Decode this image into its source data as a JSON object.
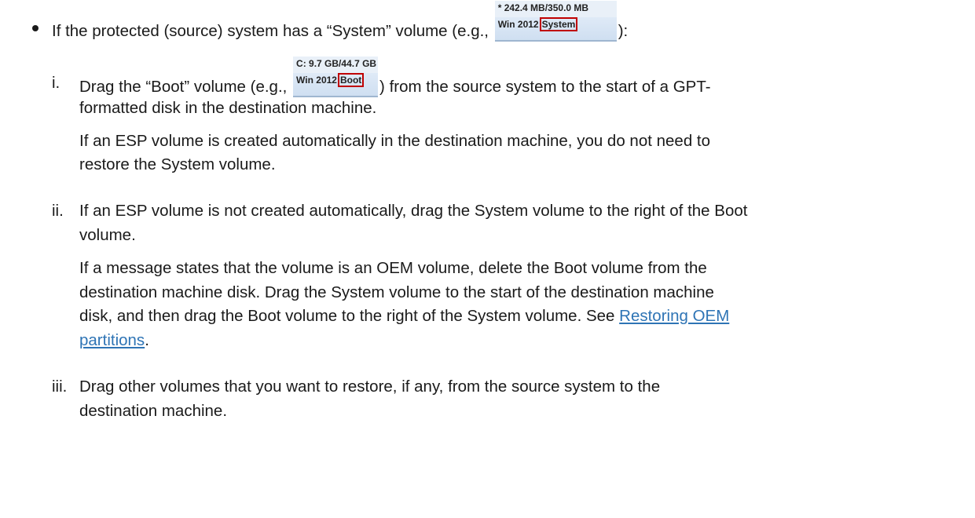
{
  "bullet": {
    "text_before": "If the protected (source) system has a “System” volume (e.g.,",
    "text_after": "):",
    "volume_image": {
      "size": "* 242.4 MB/350.0 MB",
      "os": "Win 2012",
      "tag": "System"
    }
  },
  "step_i": {
    "marker": "i.",
    "text_before": "Drag the “Boot” volume (e.g.,",
    "text_after": ") from the source system to the start of a GPT-",
    "line2": "formatted disk in the destination machine.",
    "volume_image": {
      "size": "C: 9.7 GB/44.7 GB",
      "os": "Win 2012",
      "tag": "Boot"
    },
    "note_line1": "If an ESP volume is created automatically in the destination machine, you do not need to",
    "note_line2": "restore the System volume."
  },
  "step_ii": {
    "marker": "ii.",
    "line1": "If an ESP volume is not created automatically, drag the System volume to the right of the Boot",
    "line2": "volume.",
    "note_line1": "If a message states that the volume is an OEM volume, delete the Boot volume from the",
    "note_line2": "destination machine disk. Drag the System volume to the start of the destination machine",
    "note_line3_before": "disk, and then drag the Boot volume to the right of the System volume. See",
    "link_part1": "Restoring OEM",
    "link_part2": "partitions",
    "note_line4_after": "."
  },
  "step_iii": {
    "marker": "iii.",
    "line1": "Drag other volumes that you want to restore, if any, from the source system to the",
    "line2": "destination machine."
  }
}
